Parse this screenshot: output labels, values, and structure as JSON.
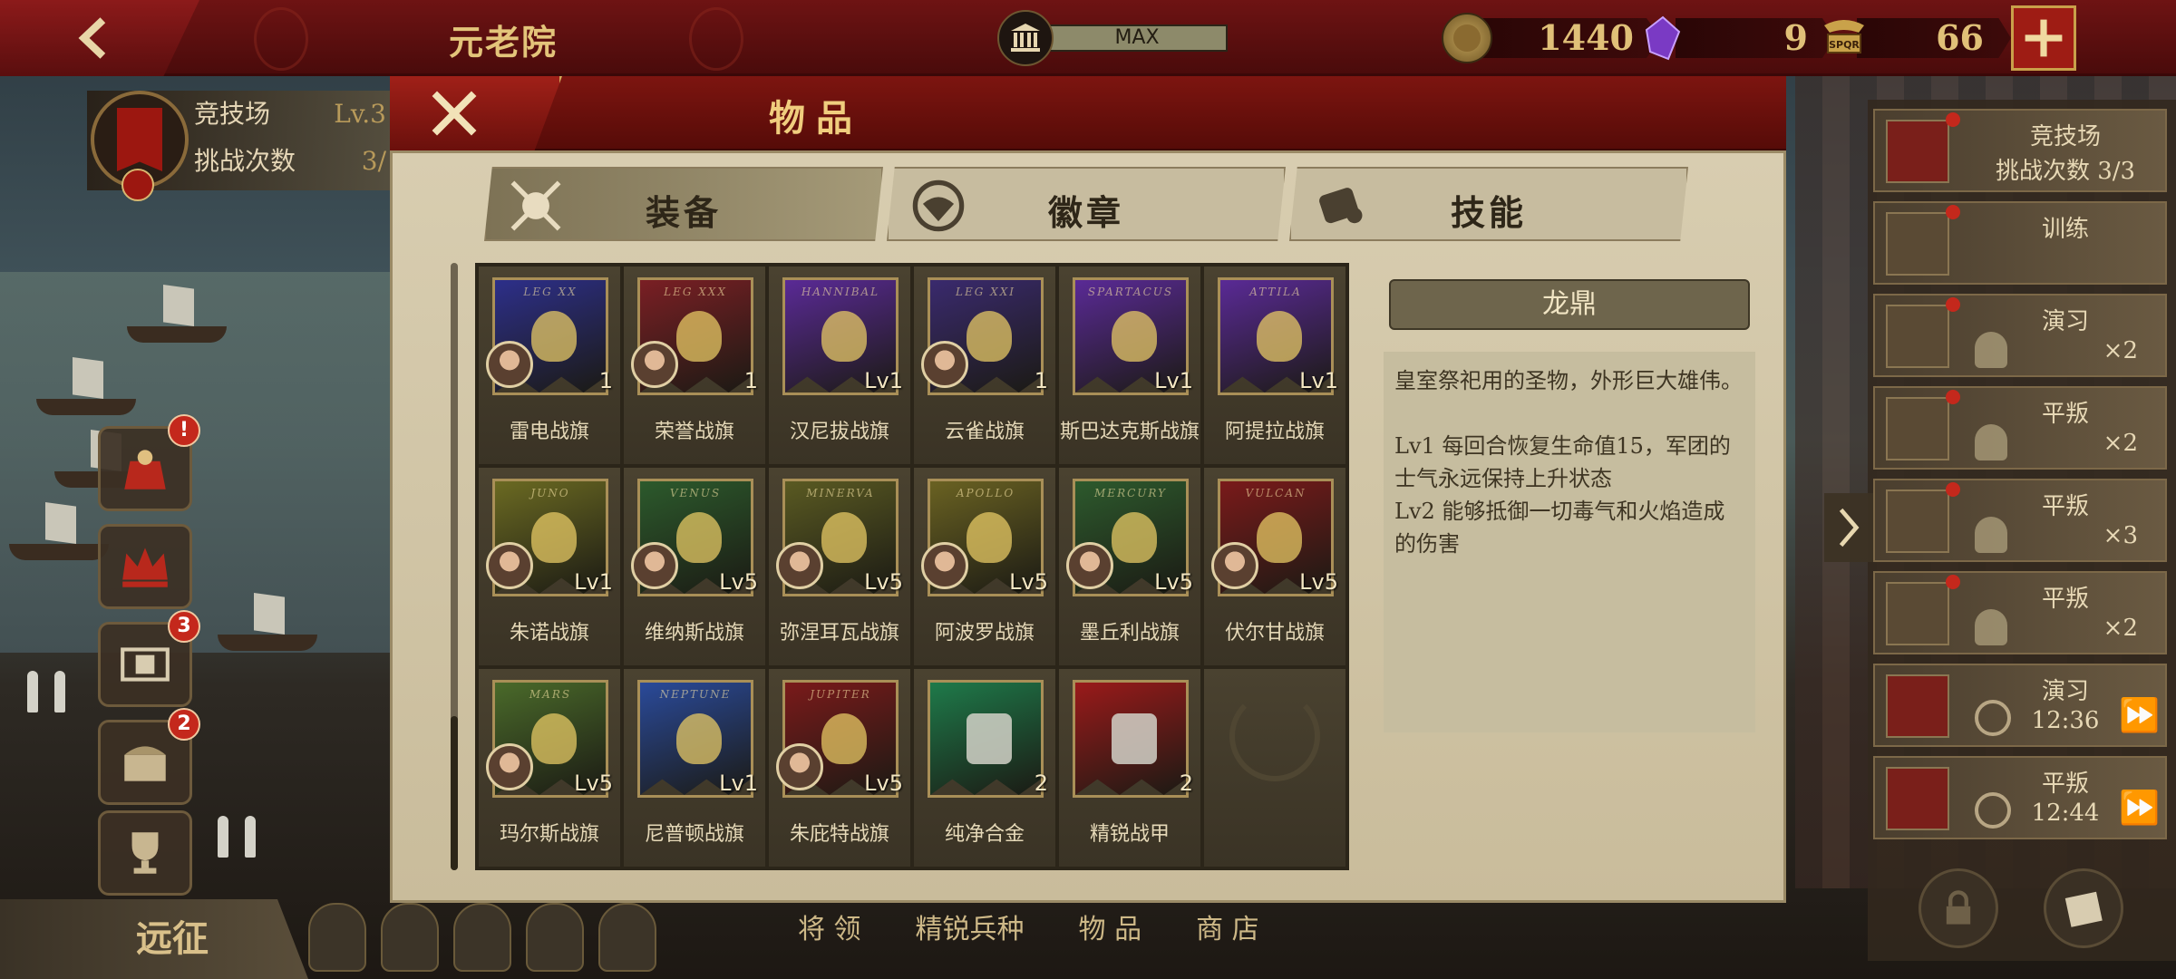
{
  "topbar": {
    "title": "元老院",
    "senate_level": "MAX",
    "coins": "1440",
    "gems": "9",
    "spqr": "66",
    "spqr_icon_text": "SPQR"
  },
  "arena_panel": {
    "title": "竞技场",
    "level": "Lv.3",
    "challenges_label": "挑战次数",
    "challenges_value": "3/"
  },
  "side_buttons": [
    {
      "icon": "gift-bag-icon",
      "badge": "!"
    },
    {
      "icon": "crown-icon",
      "badge": ""
    },
    {
      "icon": "film-icon",
      "badge": "3"
    },
    {
      "icon": "chest-icon",
      "badge": "2"
    },
    {
      "icon": "trophy-icon",
      "badge": ""
    }
  ],
  "expedition": {
    "label": "远征"
  },
  "bottom_nav": [
    "将 领",
    "精锐兵种",
    "物 品",
    "商 店"
  ],
  "modal": {
    "title": "物品",
    "tabs": [
      {
        "label": "装备",
        "icon": "sword-shield-icon",
        "active": true
      },
      {
        "label": "徽章",
        "icon": "eagle-medal-icon",
        "active": false
      },
      {
        "label": "技能",
        "icon": "scroll-icon",
        "active": false
      }
    ],
    "items": [
      {
        "name": "雷电战旗",
        "level": "1",
        "flag_text": "LEG XX",
        "color": "#2d2f8a",
        "hero": true
      },
      {
        "name": "荣誉战旗",
        "level": "1",
        "flag_text": "LEG XXX",
        "color": "#7a1f24",
        "hero": true
      },
      {
        "name": "汉尼拔战旗",
        "level": "Lv1",
        "flag_text": "HANNIBAL",
        "color": "#5a2a96",
        "hero": false
      },
      {
        "name": "云雀战旗",
        "level": "1",
        "flag_text": "LEG XXI",
        "color": "#3a2a6e",
        "hero": true
      },
      {
        "name": "斯巴达克斯战旗",
        "level": "Lv1",
        "flag_text": "SPARTACUS",
        "color": "#5a2a96",
        "hero": false
      },
      {
        "name": "阿提拉战旗",
        "level": "Lv1",
        "flag_text": "ATTILA",
        "color": "#5a2a96",
        "hero": false
      },
      {
        "name": "朱诺战旗",
        "level": "Lv1",
        "flag_text": "JUNO",
        "color": "#6b6a22",
        "hero": true
      },
      {
        "name": "维纳斯战旗",
        "level": "Lv5",
        "flag_text": "VENUS",
        "color": "#2c5a2c",
        "hero": true
      },
      {
        "name": "弥涅耳瓦战旗",
        "level": "Lv5",
        "flag_text": "MINERVA",
        "color": "#5a5a22",
        "hero": true
      },
      {
        "name": "阿波罗战旗",
        "level": "Lv5",
        "flag_text": "APOLLO",
        "color": "#6a6222",
        "hero": true
      },
      {
        "name": "墨丘利战旗",
        "level": "Lv5",
        "flag_text": "MERCURY",
        "color": "#2d5a2d",
        "hero": true
      },
      {
        "name": "伏尔甘战旗",
        "level": "Lv5",
        "flag_text": "VULCAN",
        "color": "#7a1a1a",
        "hero": true
      },
      {
        "name": "玛尔斯战旗",
        "level": "Lv5",
        "flag_text": "MARS",
        "color": "#4a6a2a",
        "hero": true
      },
      {
        "name": "尼普顿战旗",
        "level": "Lv1",
        "flag_text": "NEPTUNE",
        "color": "#2a4a9a",
        "hero": false
      },
      {
        "name": "朱庇特战旗",
        "level": "Lv5",
        "flag_text": "JUPITER",
        "color": "#7a1a1a",
        "hero": true
      },
      {
        "name": "纯净合金",
        "level": "2",
        "flag_text": "",
        "color": "#1e7a4a",
        "hero": false
      },
      {
        "name": "精锐战甲",
        "level": "2",
        "flag_text": "",
        "color": "#9a1a1a",
        "hero": false
      },
      {
        "name": "",
        "level": "",
        "flag_text": "",
        "color": "#3a3325",
        "hero": false,
        "empty": true
      }
    ],
    "detail": {
      "title": "龙鼎",
      "description": "皇室祭祀用的圣物，外形巨大雄伟。",
      "lv1": "Lv1  每回合恢复生命值15，军团的士气永远保持上升状态",
      "lv2": "Lv2  能够抵御一切毒气和火焰造成的伤害"
    }
  },
  "quests": [
    {
      "title": "竞技场",
      "sub": "挑战次数 3/3",
      "icon_red": true,
      "dot": true,
      "kind": "text"
    },
    {
      "title": "训练",
      "sub": "",
      "icon_red": false,
      "dot": true,
      "kind": "plain"
    },
    {
      "title": "演习",
      "sub": "×2",
      "icon_red": false,
      "dot": true,
      "kind": "helm"
    },
    {
      "title": "平叛",
      "sub": "×2",
      "icon_red": false,
      "dot": true,
      "kind": "helm"
    },
    {
      "title": "平叛",
      "sub": "×3",
      "icon_red": false,
      "dot": true,
      "kind": "helm"
    },
    {
      "title": "平叛",
      "sub": "×2",
      "icon_red": false,
      "dot": true,
      "kind": "helm"
    },
    {
      "title": "演习",
      "sub": "12:36",
      "icon_red": true,
      "dot": false,
      "kind": "timer"
    },
    {
      "title": "平叛",
      "sub": "12:44",
      "icon_red": true,
      "dot": false,
      "kind": "timer"
    }
  ],
  "colors": {
    "crimson": "#6e1313",
    "gold": "#e3c47a",
    "parchment": "#d8cdb0"
  }
}
